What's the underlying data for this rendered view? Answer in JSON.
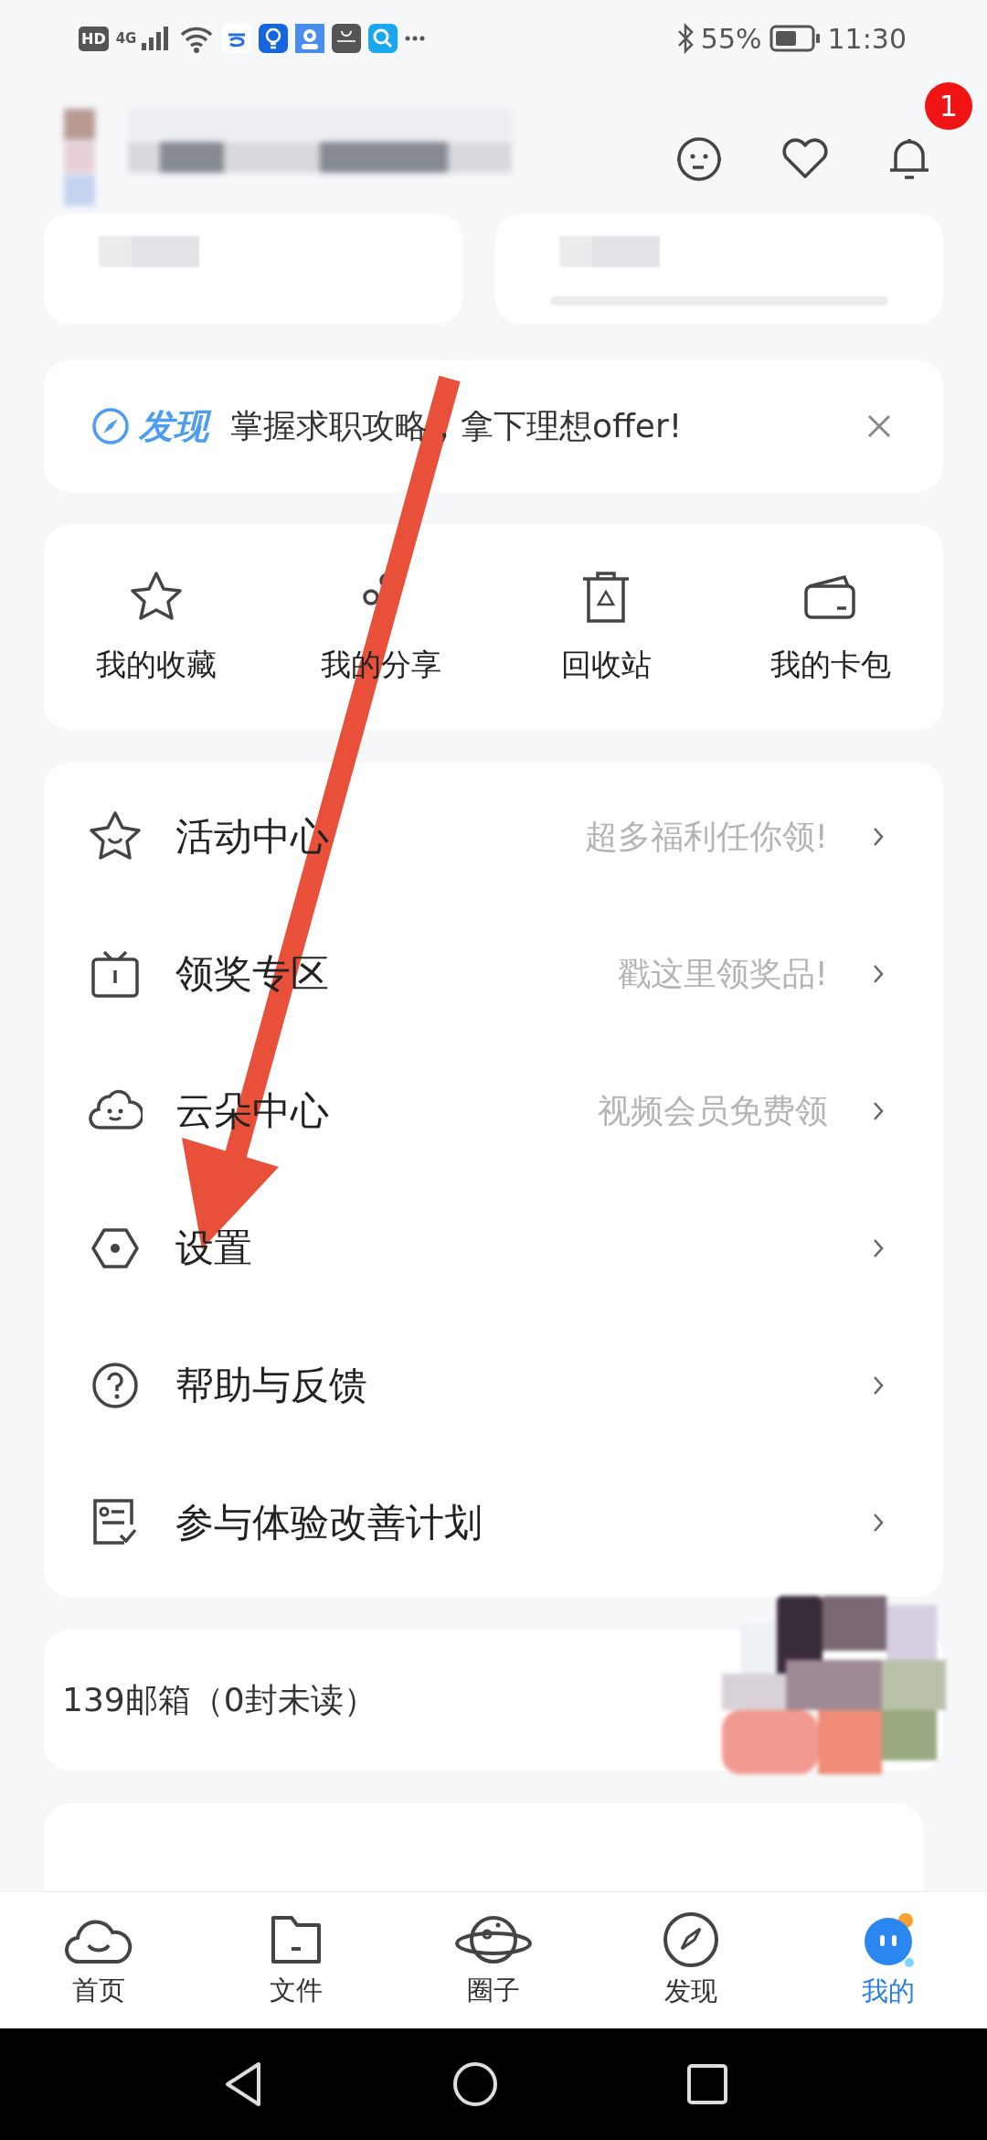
{
  "status_bar": {
    "hd_label": "HD",
    "network_label": "4G",
    "battery": "55%",
    "time": "11:30"
  },
  "header": {
    "notification_count": "1"
  },
  "discover_banner": {
    "tag": "发现",
    "text": "掌握求职攻略，拿下理想offer!"
  },
  "shortcuts": [
    {
      "label": "我的收藏"
    },
    {
      "label": "我的分享"
    },
    {
      "label": "回收站"
    },
    {
      "label": "我的卡包"
    }
  ],
  "menu": [
    {
      "label": "活动中心",
      "hint": "超多福利任你领!"
    },
    {
      "label": "领奖专区",
      "hint": "戳这里领奖品!"
    },
    {
      "label": "云朵中心",
      "hint": "视频会员免费领"
    },
    {
      "label": "设置"
    },
    {
      "label": "帮助与反馈"
    },
    {
      "label": "参与体验改善计划"
    }
  ],
  "mail": {
    "text": "139邮箱（0封未读）"
  },
  "bottom_nav": [
    {
      "label": "首页",
      "selected": false
    },
    {
      "label": "文件",
      "selected": false
    },
    {
      "label": "圈子",
      "selected": false
    },
    {
      "label": "发现",
      "selected": false
    },
    {
      "label": "我的",
      "selected": true
    }
  ]
}
